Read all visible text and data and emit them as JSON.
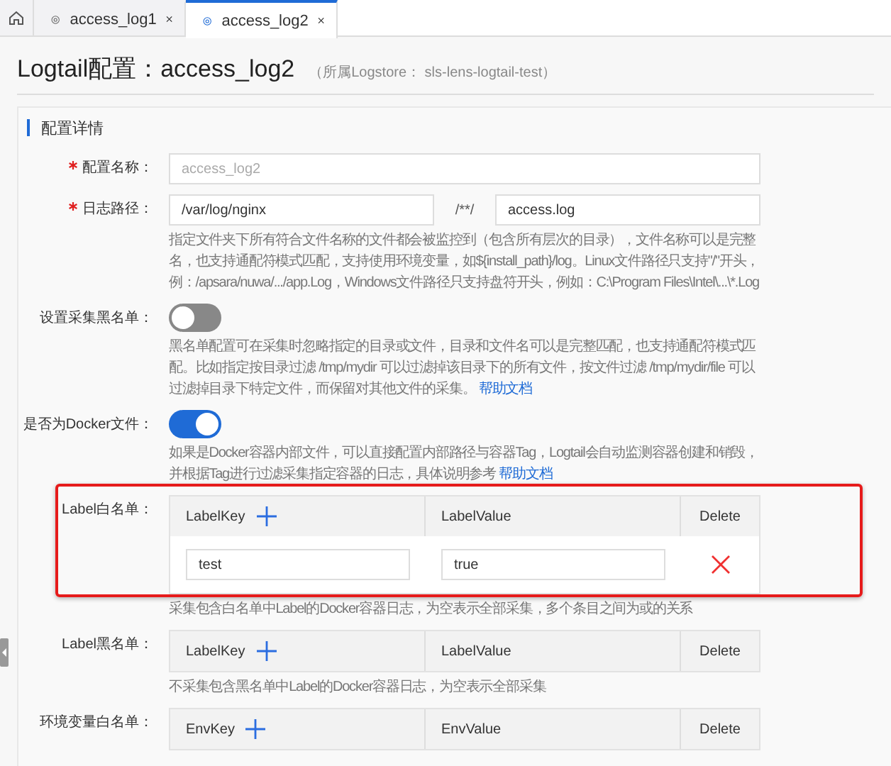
{
  "tabs": [
    {
      "label": "access_log1",
      "selected": false
    },
    {
      "label": "access_log2",
      "selected": true
    }
  ],
  "page": {
    "title": "Logtail配置：access_log2",
    "subtitle": "（所属Logstore： sls-lens-logtail-test）"
  },
  "section": {
    "title": "配置详情"
  },
  "fields": [
    {
      "kind": "input",
      "label": "配置名称：",
      "required": true,
      "value": "access_log2",
      "disabled": true
    },
    {
      "kind": "path",
      "label": "日志路径：",
      "required": true,
      "dir": "/var/log/nginx",
      "separator": "/**/",
      "file": "access.log",
      "help": "指定文件夹下所有符合文件名称的文件都会被监控到（包含所有层次的目录），文件名称可以是完整名，也支持通配符模式匹配，支持使用环境变量，如${install_path}/log。Linux文件路径只支持\"/\"开头，例：/apsara/nuwa/.../app.Log，Windows文件路径只支持盘符开头，例如：C:\\Program Files\\Intel\\...\\*.Log"
    },
    {
      "kind": "switch",
      "label": "设置采集黑名单：",
      "required": false,
      "on": false,
      "help": "黑名单配置可在采集时忽略指定的目录或文件，目录和文件名可以是完整匹配，也支持通配符模式匹配。比如指定按目录过滤 /tmp/mydir 可以过滤掉该目录下的所有文件，按文件过滤 /tmp/mydir/file 可以过滤掉目录下特定文件，而保留对其他文件的采集。",
      "help_link": "帮助文档"
    },
    {
      "kind": "switch",
      "label": "是否为Docker文件：",
      "required": false,
      "on": true,
      "help": "如果是Docker容器内部文件，可以直接配置内部路径与容器Tag，Logtail会自动监测容器创建和销毁，并根据Tag进行过滤采集指定容器的日志，具体说明参考",
      "help_link": "帮助文档"
    },
    {
      "kind": "table",
      "label": "Label白名单：",
      "required": false,
      "highlighted": true,
      "columns": [
        "LabelKey",
        "LabelValue",
        "Delete"
      ],
      "rows": [
        {
          "key": "test",
          "value": "true"
        }
      ],
      "help": "采集包含白名单中Label的Docker容器日志，为空表示全部采集，多个条目之间为或的关系"
    },
    {
      "kind": "table",
      "label": "Label黑名单：",
      "required": false,
      "highlighted": false,
      "columns": [
        "LabelKey",
        "LabelValue",
        "Delete"
      ],
      "help": "不采集包含黑名单中Label的Docker容器日志，为空表示全部采集"
    },
    {
      "kind": "table",
      "label": "环境变量白名单：",
      "required": false,
      "highlighted": false,
      "columns": [
        "EnvKey",
        "EnvValue",
        "Delete"
      ]
    }
  ]
}
